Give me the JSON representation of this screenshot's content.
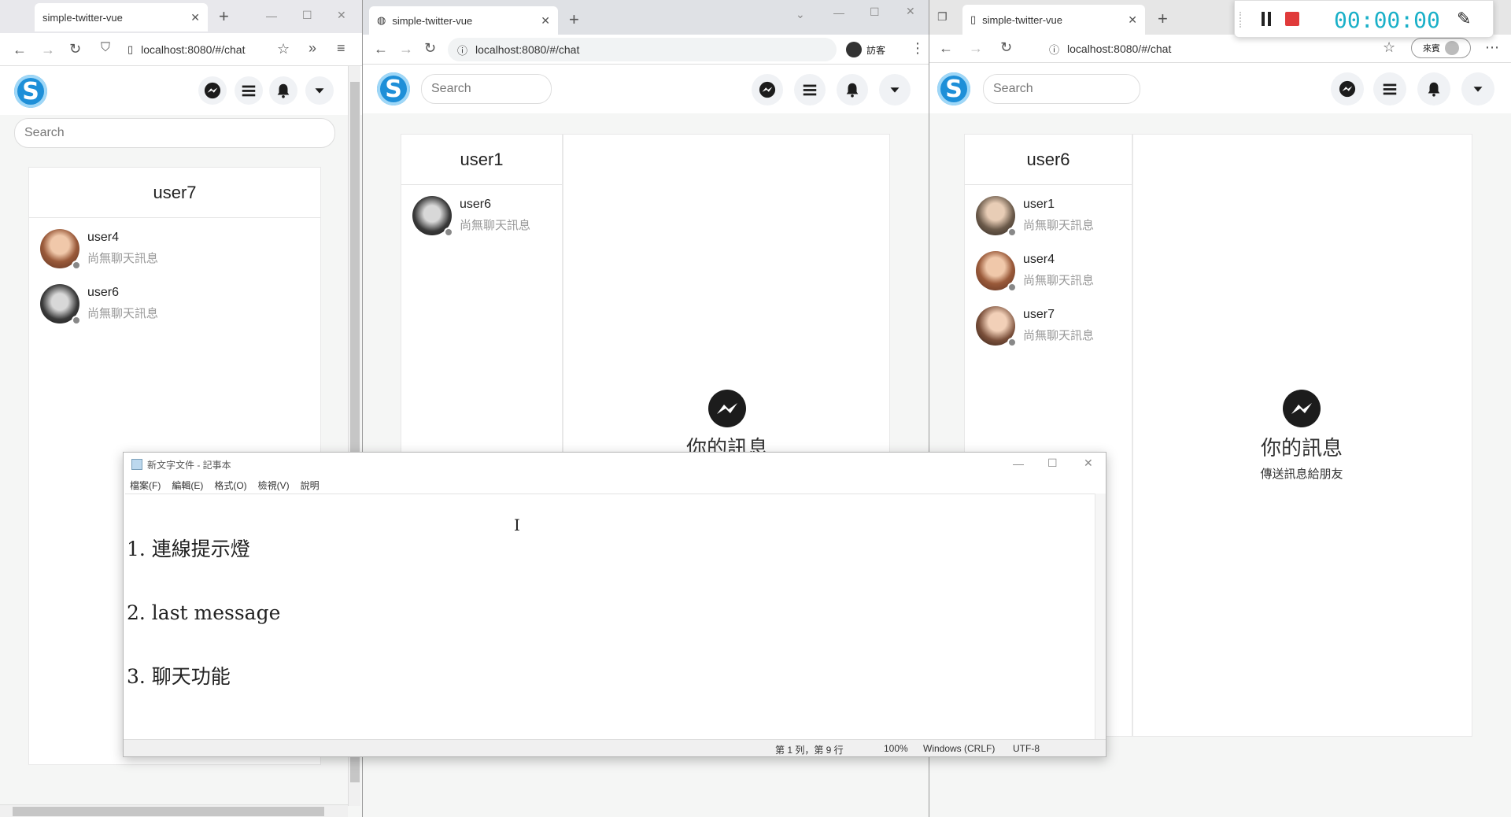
{
  "app": {
    "brand_letter": "S",
    "search_placeholder": "Search"
  },
  "browsers": {
    "left": {
      "tab_title": "simple-twitter-vue",
      "url": "localhost:8080/#/chat",
      "current_user": "user7",
      "rooms": [
        {
          "name": "user4",
          "last": "尚無聊天訊息",
          "avatar_color": "#c98a6a"
        },
        {
          "name": "user6",
          "last": "尚無聊天訊息",
          "avatar_color": "#3a3a3a"
        }
      ]
    },
    "middle": {
      "tab_title": "simple-twitter-vue",
      "url": "localhost:8080/#/chat",
      "profile_label": "訪客",
      "current_user": "user1",
      "rooms": [
        {
          "name": "user6",
          "last": "尚無聊天訊息",
          "avatar_color": "#3a3a3a"
        }
      ],
      "empty_title": "你的訊息"
    },
    "right": {
      "tab_title": "simple-twitter-vue",
      "url": "localhost:8080/#/chat",
      "profile_label": "來賓",
      "current_user": "user6",
      "rooms": [
        {
          "name": "user1",
          "last": "尚無聊天訊息",
          "avatar_color": "#6b5a4a"
        },
        {
          "name": "user4",
          "last": "尚無聊天訊息",
          "avatar_color": "#c98a6a"
        },
        {
          "name": "user7",
          "last": "尚無聊天訊息",
          "avatar_color": "#7a4f3a"
        }
      ],
      "empty_title": "你的訊息",
      "empty_subtitle": "傳送訊息給朋友"
    }
  },
  "notepad": {
    "title": "新文字文件 - 記事本",
    "menu": [
      "檔案(F)",
      "編輯(E)",
      "格式(O)",
      "檢視(V)",
      "說明"
    ],
    "lines": [
      "1. 連線提示燈",
      "2. last message",
      "3. 聊天功能"
    ],
    "status": {
      "position": "第 1 列，第 9 行",
      "zoom": "100%",
      "eol": "Windows (CRLF)",
      "encoding": "UTF-8"
    }
  },
  "recorder": {
    "time": "00:00:00"
  },
  "colors": {
    "brand": "#1e8fd8",
    "status_offline": "#888888",
    "recorder_time": "#1ab0c8",
    "recorder_stop": "#e03a3a"
  }
}
